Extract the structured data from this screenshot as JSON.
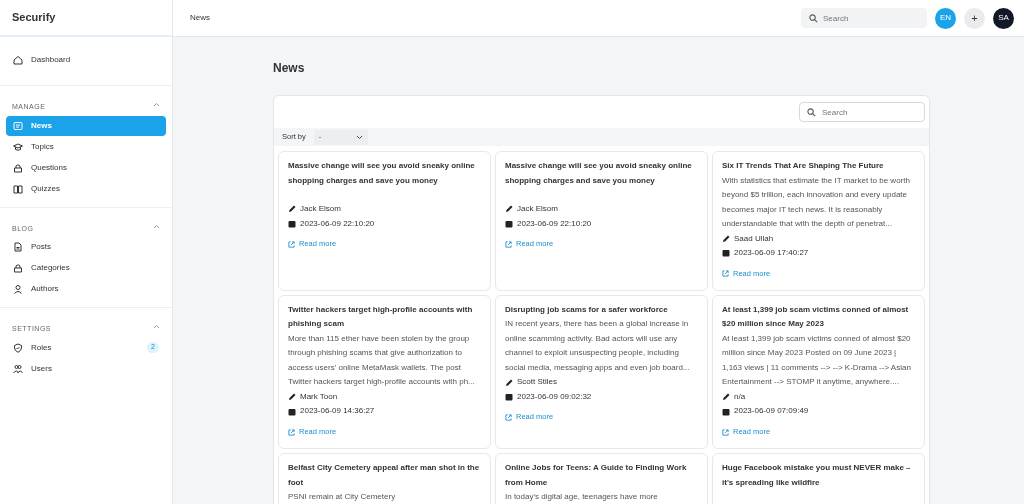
{
  "brand": "Securify",
  "topbar": {
    "breadcrumb": "News",
    "search": {
      "placeholder": "Search"
    },
    "language": "EN",
    "add_label": "+",
    "avatar": "SA"
  },
  "sidebar": {
    "top": [
      {
        "label": "Dashboard",
        "kind": "home",
        "selected": false
      }
    ],
    "sections": [
      {
        "title": "MANAGE",
        "expanded": true,
        "items": [
          {
            "label": "News",
            "kind": "news",
            "selected": true
          },
          {
            "label": "Topics",
            "kind": "cap",
            "selected": false
          },
          {
            "label": "Questions",
            "kind": "bag",
            "selected": false
          },
          {
            "label": "Quizzes",
            "kind": "book",
            "selected": false
          }
        ]
      },
      {
        "title": "BLOG",
        "expanded": true,
        "items": [
          {
            "label": "Posts",
            "kind": "doc",
            "selected": false
          },
          {
            "label": "Categories",
            "kind": "bag",
            "selected": false
          },
          {
            "label": "Authors",
            "kind": "person",
            "selected": false
          }
        ]
      },
      {
        "title": "SETTINGS",
        "expanded": true,
        "items": [
          {
            "label": "Roles",
            "kind": "shield",
            "selected": false,
            "badge": "2"
          },
          {
            "label": "Users",
            "kind": "users",
            "selected": false
          }
        ]
      }
    ]
  },
  "page": {
    "title": "News",
    "search": {
      "placeholder": "Search"
    },
    "sort": {
      "label": "Sort by",
      "value": "-"
    }
  },
  "articles": [
    {
      "title": "Massive change will see you avoid sneaky online shopping charges and save you money",
      "author": "Jack Elsom",
      "date": "2023-06-09 22:10:20",
      "link": "Read more"
    },
    {
      "title": "Massive change will see you avoid sneaky online shopping charges and save you money",
      "author": "Jack Elsom",
      "date": "2023-06-09 22:10:20",
      "link": "Read more"
    },
    {
      "title": "Six IT Trends That Are Shaping The Future",
      "excerpt": "With statistics that estimate the IT market to be worth beyond $5 trillion, each innovation and every update becomes major IT tech news. It is reasonably understandable that with the depth of penetrat...",
      "author": "Saad Ullah",
      "date": "2023-06-09 17:40:27",
      "link": "Read more"
    },
    {
      "title": "Twitter hackers target high-profile accounts with phishing scam",
      "excerpt": "More than 115 ether have been stolen by the group through phishing scams that give authorization to access users' online MetaMask wallets. The post Twitter hackers target high-profile accounts with ph...",
      "author": "Mark Toon",
      "date": "2023-06-09 14:36:27",
      "link": "Read more"
    },
    {
      "title": "Disrupting job scams for a safer workforce",
      "excerpt": "IN recent years, there has been a global increase in online scamming activity. Bad actors will use any channel to exploit unsuspecting people, including social media, messaging apps and even job board...",
      "author": "Scott Stiles",
      "date": "2023-06-09 09:02:32",
      "link": "Read more"
    },
    {
      "title": "At least 1,399 job scam victims conned of almost $20 million since May 2023",
      "excerpt": "At least 1,399 job scam victims conned of almost $20 million since May 2023 Posted on 09 June 2023 | 1,163 views | 11 comments --> --> K-Drama  --> Asian Entertainment --> STOMP it anytime, anywhere....",
      "author": "n/a",
      "date": "2023-06-09 07:09:49",
      "link": "Read more"
    },
    {
      "title": "Belfast City Cemetery appeal after man shot in the foot",
      "excerpt": "PSNI remain at City Cemetery"
    },
    {
      "title": "Online Jobs for Teens: A Guide to Finding Work from Home",
      "excerpt": "In today's digital age, teenagers have more"
    },
    {
      "title": "Huge Facebook mistake you must NEVER make – it's spreading like wildfire"
    }
  ]
}
